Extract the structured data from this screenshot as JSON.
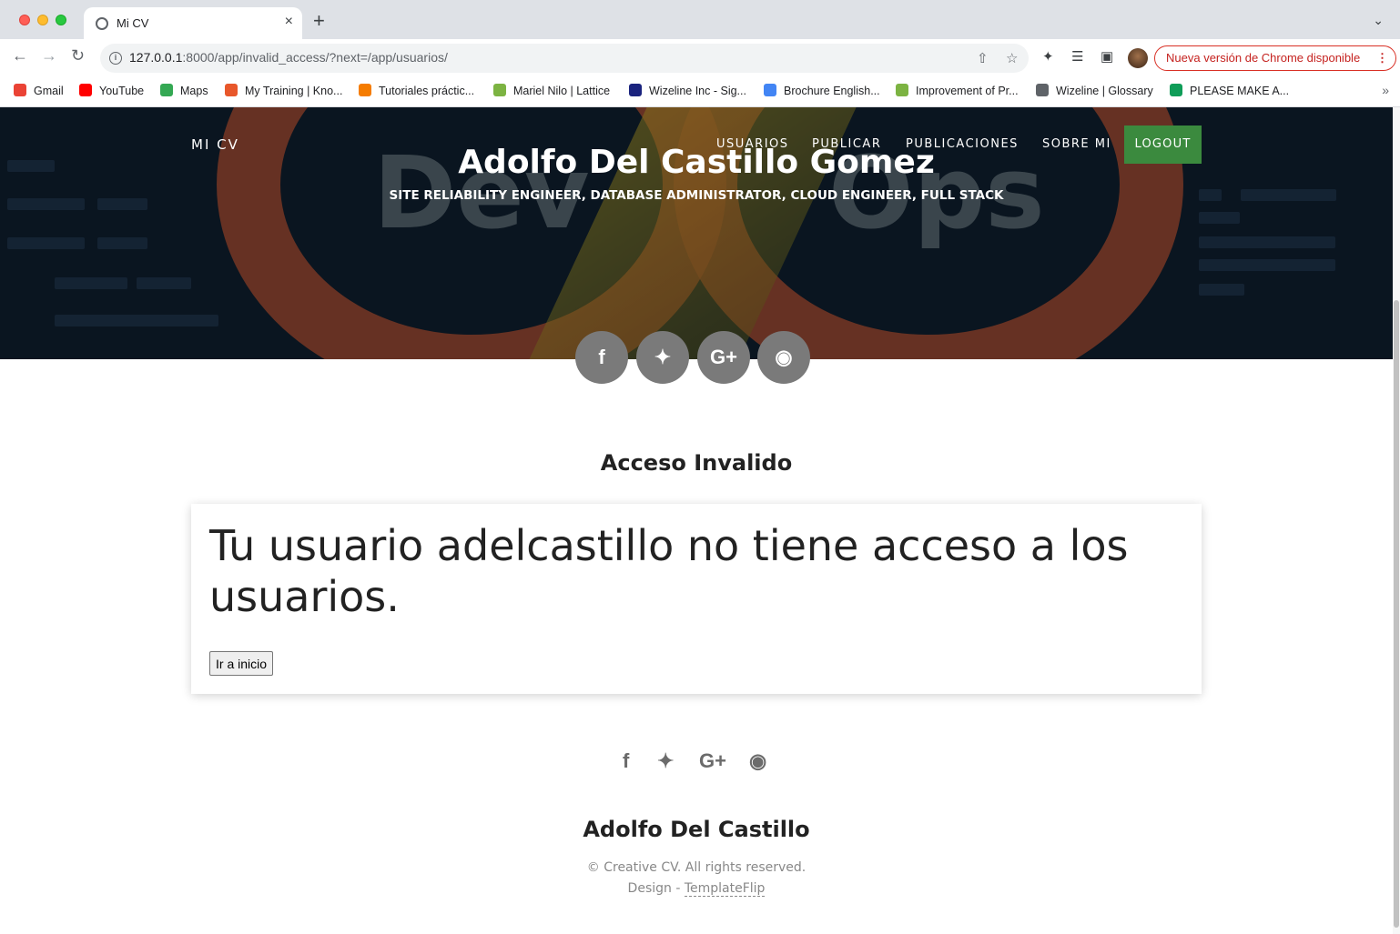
{
  "browser": {
    "tab_title": "Mi CV",
    "tab_close": "×",
    "new_tab": "+",
    "url_host": "127.0.0.1",
    "url_rest": ":8000/app/invalid_access/?next=/app/usuarios/",
    "update_label": "Nueva versión de Chrome disponible",
    "bookmarks": [
      {
        "label": "Gmail",
        "color": "#ea4335"
      },
      {
        "label": "YouTube",
        "color": "#ff0000"
      },
      {
        "label": "Maps",
        "color": "#34a853"
      },
      {
        "label": "My Training | Kno...",
        "color": "#e8572a"
      },
      {
        "label": "Tutoriales práctic...",
        "color": "#f57c00"
      },
      {
        "label": "Mariel Nilo | Lattice",
        "color": "#7cb342"
      },
      {
        "label": "Wizeline Inc - Sig...",
        "color": "#1a237e"
      },
      {
        "label": "Brochure English...",
        "color": "#4285f4"
      },
      {
        "label": "Improvement of Pr...",
        "color": "#7cb342"
      },
      {
        "label": "Wizeline | Glossary",
        "color": "#5f6368"
      },
      {
        "label": "PLEASE MAKE A...",
        "color": "#0f9d58"
      }
    ]
  },
  "nav": {
    "brand": "MI CV",
    "links": [
      "USUARIOS",
      "PUBLICAR",
      "PUBLICACIONES",
      "SOBRE MI"
    ],
    "logout": "LOGOUT",
    "logout_color": "#3b8a3e"
  },
  "hero": {
    "bg_text_left": "Dev",
    "bg_text_right": "Ops",
    "title": "Adolfo Del Castillo Gomez",
    "subtitle": "SITE RELIABILITY ENGINEER, DATABASE ADMINISTRATOR, CLOUD ENGINEER, FULL STACK",
    "social": [
      "facebook-icon",
      "twitter-icon",
      "google-plus-icon",
      "instagram-icon"
    ]
  },
  "main": {
    "section_title": "Acceso Invalido",
    "message": "Tu usuario adelcastillo no tiene acceso a los usuarios.",
    "button_label": "Ir a inicio"
  },
  "footer": {
    "name": "Adolfo Del Castillo",
    "copyright": "© Creative CV. All rights reserved.",
    "design_prefix": "Design - ",
    "design_link": "TemplateFlip"
  }
}
